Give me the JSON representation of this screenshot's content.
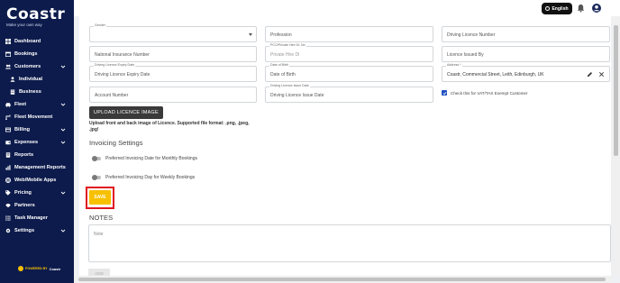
{
  "brand": {
    "logo": "Coastr",
    "tagline": "Make your own way",
    "accent": "#f7c000",
    "sidebar_bg": "#0d1b4c"
  },
  "topbar": {
    "language": "English",
    "bell_icon": "bell-icon",
    "user_icon": "user-icon"
  },
  "sidebar": {
    "items": [
      {
        "label": "Dashboard",
        "icon": "grid-icon"
      },
      {
        "label": "Bookings",
        "icon": "calendar-icon"
      },
      {
        "label": "Customers",
        "icon": "users-icon"
      },
      {
        "label": "Individual",
        "icon": "user-icon"
      },
      {
        "label": "Business",
        "icon": "building-icon"
      },
      {
        "label": "Fleet",
        "icon": "car-icon"
      },
      {
        "label": "Fleet Movement",
        "icon": "route-icon"
      },
      {
        "label": "Billing",
        "icon": "billing-icon"
      },
      {
        "label": "Expenses",
        "icon": "wallet-icon"
      },
      {
        "label": "Reports",
        "icon": "report-icon"
      },
      {
        "label": "Management Reports",
        "icon": "chart-icon"
      },
      {
        "label": "Web/Mobile Apps",
        "icon": "globe-icon"
      },
      {
        "label": "Pricing",
        "icon": "tag-icon"
      },
      {
        "label": "Partners",
        "icon": "handshake-icon"
      },
      {
        "label": "Task Manager",
        "icon": "tasks-icon"
      },
      {
        "label": "Settings",
        "icon": "gear-icon"
      }
    ],
    "powered_by": "POWERED BY",
    "powered_brand": "Coastr"
  },
  "form": {
    "gender_label": "Gender",
    "profession_placeholder": "Profession",
    "driving_licence_number_placeholder": "Driving Licence Number",
    "national_insurance_placeholder": "National Insurance Number",
    "pco_label": "PCO/Private Hire DL No",
    "pco_placeholder": "Private Hire Dl",
    "licence_issued_by_placeholder": "Licence Issued By",
    "dl_expiry_label": "Driving Licence Expiry Date",
    "dl_expiry_placeholder": "Driving Licence Expiry Date",
    "dob_label": "Date of Birth",
    "dob_placeholder": "Date of Birth",
    "address_label": "Address *",
    "address_value": "Coastr, Commercial Street, Leith, Edinburgh, UK",
    "account_number_placeholder": "Account Number",
    "dl_issue_label": "Driving Licence Issue Date",
    "dl_issue_placeholder": "Driving Licence Issue Date",
    "vat_checkbox_label": "Check this for VAT/TAX Exempt Customer",
    "upload_button": "UPLOAD LICENCE IMAGE",
    "upload_note": "Upload front and back image of Licence. Supported file format: .png, .jpeg, .jpg!"
  },
  "invoicing": {
    "title": "Invoicing Settings",
    "monthly_label": "Preferred Invoicing Date for Monthly Bookings",
    "weekly_label": "Preferred Invoicing Day for Weekly Bookings",
    "save_button": "SAVE"
  },
  "notes": {
    "title": "NOTES",
    "note_placeholder": "Note",
    "add_button": "ADD"
  }
}
